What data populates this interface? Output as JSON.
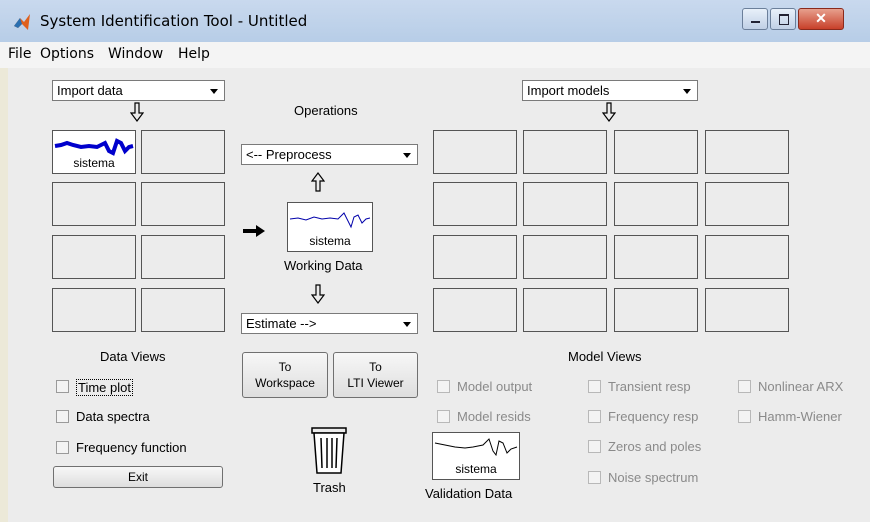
{
  "window": {
    "title": "System Identification Tool - Untitled"
  },
  "menu": [
    "File",
    "Options",
    "Window",
    "Help"
  ],
  "import_data": {
    "selected": "Import data"
  },
  "import_models": {
    "selected": "Import models"
  },
  "operations": {
    "title": "Operations",
    "preprocess": "<-- Preprocess",
    "estimate": "Estimate -->",
    "working_data_name": "sistema",
    "working_data_label": "Working Data"
  },
  "data_board": {
    "first_item": "sistema",
    "label": "Data Views"
  },
  "data_views": {
    "time_plot": "Time plot",
    "data_spectra": "Data spectra",
    "frequency_function": "Frequency function"
  },
  "buttons": {
    "exit": "Exit",
    "to_workspace": [
      "To",
      "Workspace"
    ],
    "to_lti_viewer": [
      "To",
      "LTI Viewer"
    ]
  },
  "trash": {
    "label": "Trash"
  },
  "validation": {
    "name": "sistema",
    "label": "Validation Data"
  },
  "model_views": {
    "label": "Model Views",
    "options": {
      "model_output": "Model output",
      "model_resids": "Model resids",
      "transient_resp": "Transient resp",
      "frequency_resp": "Frequency resp",
      "zeros_and_poles": "Zeros and poles",
      "noise_spectrum": "Noise spectrum",
      "nonlinear_arx": "Nonlinear ARX",
      "hamm_wiener": "Hamm-Wiener"
    }
  },
  "colors": {
    "signal_thick": "#0000cc",
    "signal_thin": "#0000aa",
    "disabled_text": "#8a8a8a"
  }
}
